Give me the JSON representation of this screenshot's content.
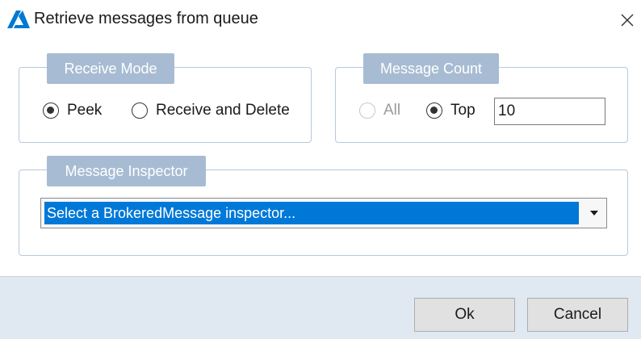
{
  "window": {
    "title": "Retrieve messages from queue",
    "app_icon": "azure-logo-icon",
    "close_icon": "close-icon"
  },
  "receive_mode": {
    "header": "Receive Mode",
    "options": [
      {
        "label": "Peek",
        "checked": true
      },
      {
        "label": "Receive and Delete",
        "checked": false
      }
    ]
  },
  "message_count": {
    "header": "Message Count",
    "options": [
      {
        "label": "All",
        "checked": false,
        "enabled": false
      },
      {
        "label": "Top",
        "checked": true,
        "enabled": true
      }
    ],
    "count_value": "10"
  },
  "message_inspector": {
    "header": "Message Inspector",
    "selected": "Select a BrokeredMessage inspector...",
    "arrow_icon": "dropdown-arrow-icon"
  },
  "buttons": {
    "ok": "Ok",
    "cancel": "Cancel"
  },
  "colors": {
    "group_header_bg": "#a7bcd3",
    "selection_blue": "#0078d7",
    "footer_bg": "#e0e8f2",
    "azure_blue": "#0078d4"
  }
}
